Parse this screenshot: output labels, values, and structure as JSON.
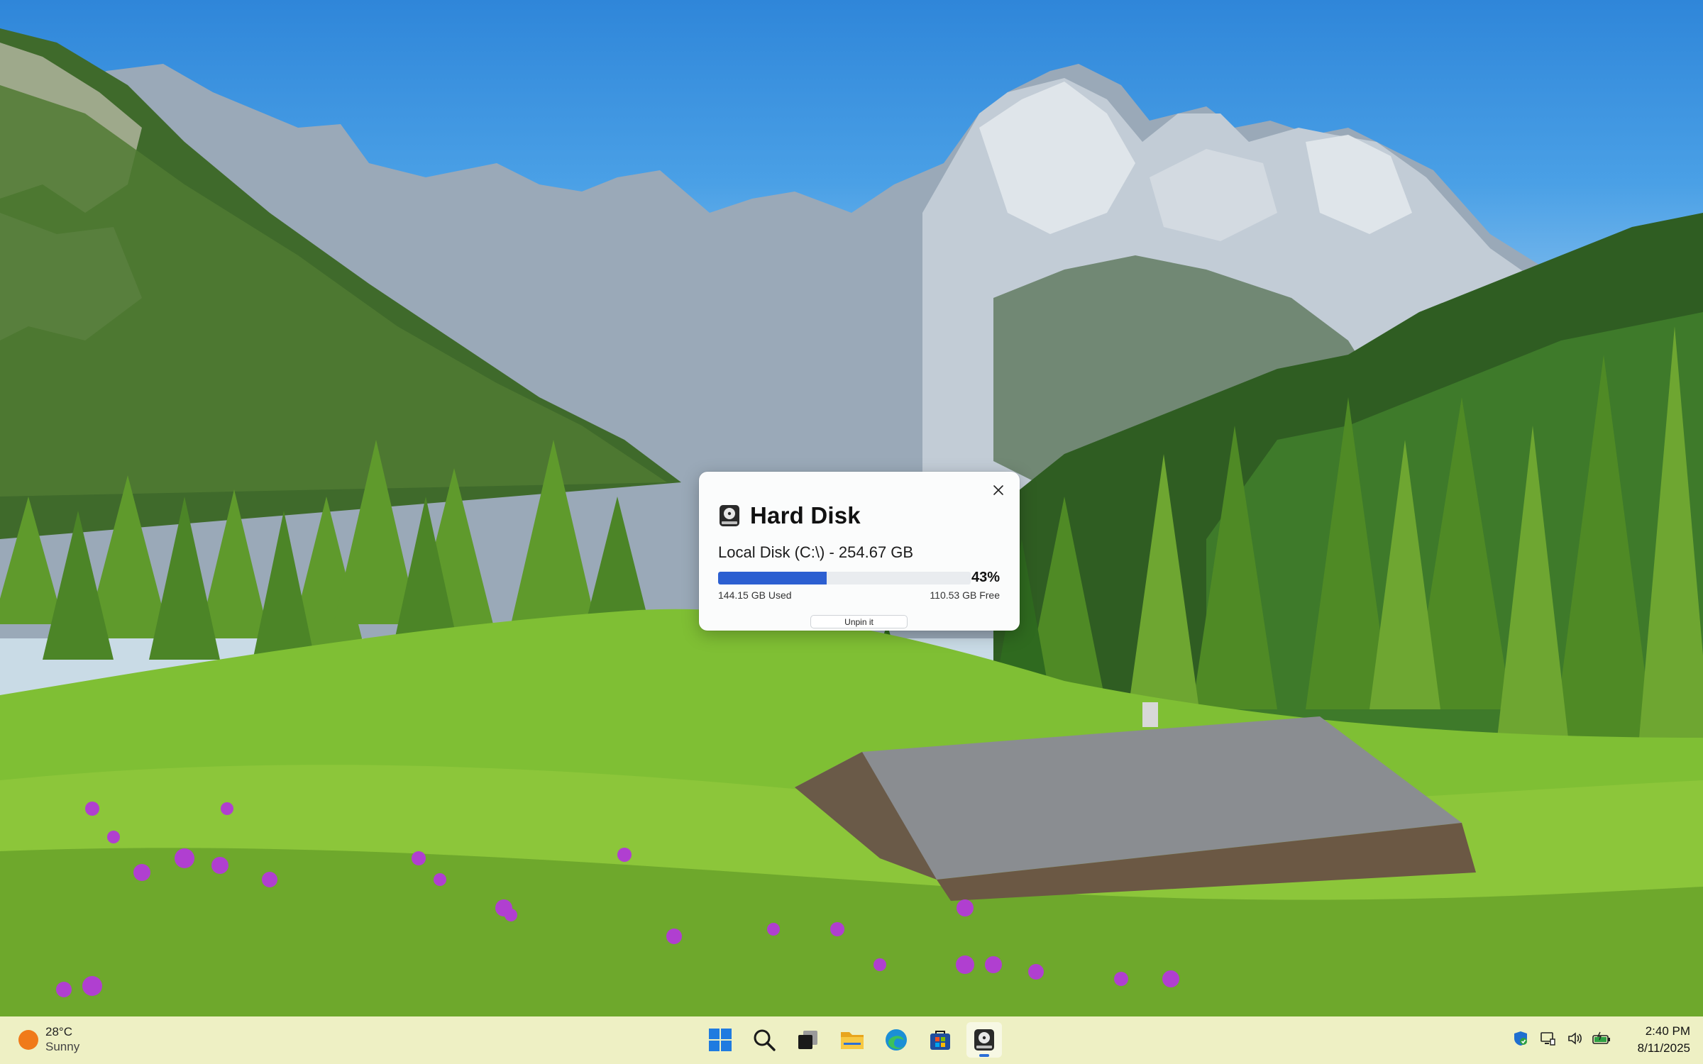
{
  "widget": {
    "title": "Hard Disk",
    "disk_label": "Local Disk (C:\\) - 254.67 GB",
    "percent_label": "43%",
    "used_fraction": 0.43,
    "used_label": "144.15 GB Used",
    "free_label": "110.53 GB Free",
    "unpin_label": "Unpin it",
    "close_icon": "close-icon",
    "disk_icon": "hard-disk-icon"
  },
  "taskbar": {
    "weather": {
      "temp": "28°C",
      "condition": "Sunny",
      "icon": "sun-icon"
    },
    "apps": [
      {
        "name": "start",
        "icon": "windows-icon"
      },
      {
        "name": "search",
        "icon": "search-icon"
      },
      {
        "name": "task-view",
        "icon": "task-view-icon"
      },
      {
        "name": "file-explorer",
        "icon": "folder-icon"
      },
      {
        "name": "edge",
        "icon": "edge-icon"
      },
      {
        "name": "store",
        "icon": "store-icon"
      },
      {
        "name": "hard-disk-widget",
        "icon": "hard-disk-icon",
        "active": true
      }
    ],
    "tray": [
      "shield-icon",
      "network-icon",
      "volume-icon",
      "battery-icon"
    ],
    "clock": {
      "time": "2:40 PM",
      "date": "8/11/2025"
    }
  },
  "colors": {
    "accent": "#2c5fd1",
    "taskbar_bg": "#eef0c4",
    "widget_bg": "#fbfcfc"
  }
}
